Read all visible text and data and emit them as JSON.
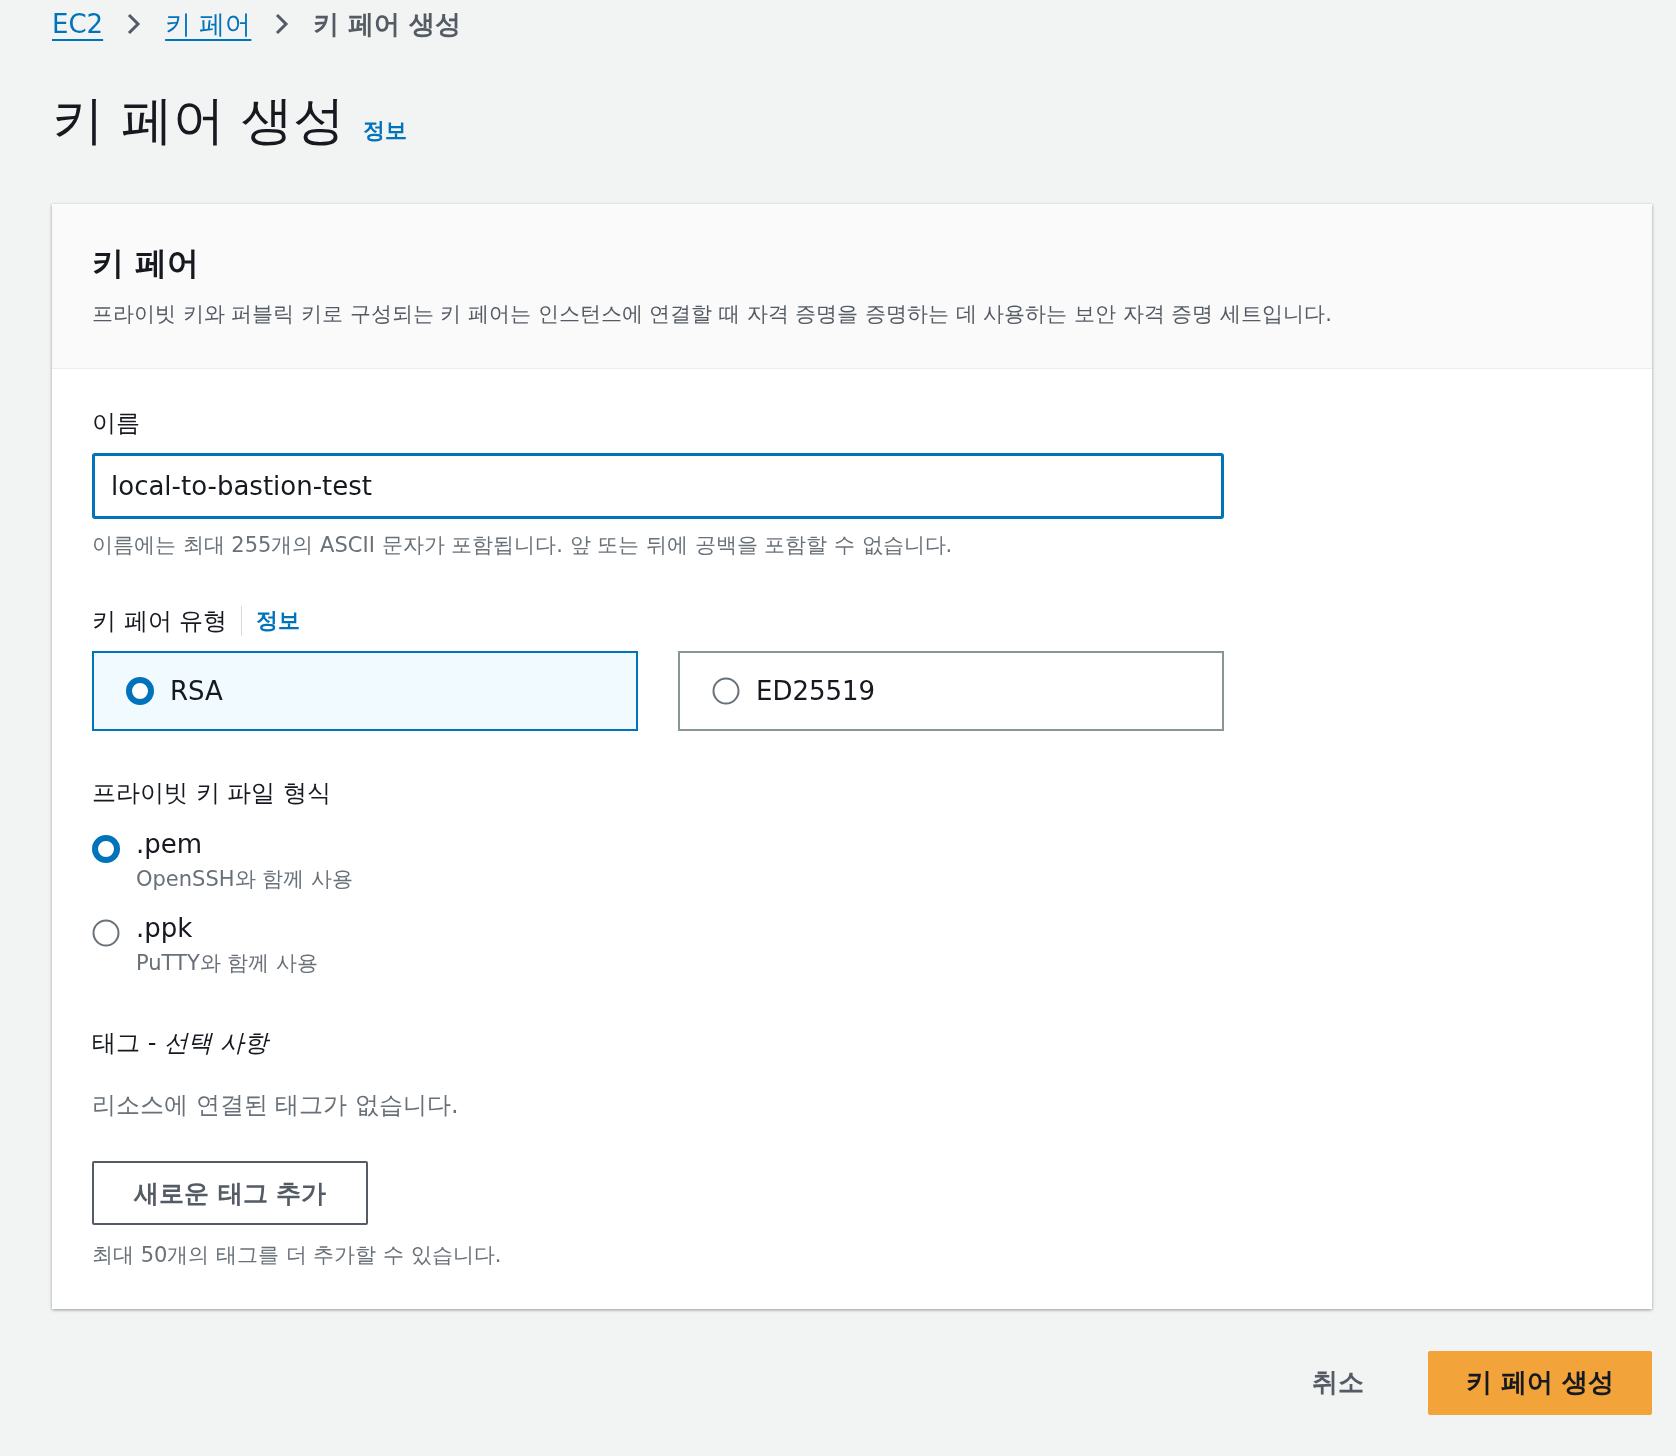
{
  "breadcrumb": [
    {
      "label": "EC2",
      "link": true
    },
    {
      "label": "키 페어",
      "link": true
    },
    {
      "label": "키 페어 생성",
      "link": false
    }
  ],
  "title": "키 페어 생성",
  "title_info": "정보",
  "card": {
    "heading": "키 페어",
    "description": "프라이빗 키와 퍼블릭 키로 구성되는 키 페어는 인스턴스에 연결할 때 자격 증명을 증명하는 데 사용하는 보안 자격 증명 세트입니다."
  },
  "name_field": {
    "label": "이름",
    "value": "local-to-bastion-test",
    "focused": true,
    "hint": "이름에는 최대 255개의 ASCII 문자가 포함됩니다. 앞 또는 뒤에 공백을 포함할 수 없습니다."
  },
  "key_type": {
    "label": "키 페어 유형",
    "info": "정보",
    "options": [
      {
        "label": "RSA",
        "selected": true
      },
      {
        "label": "ED25519",
        "selected": false
      }
    ]
  },
  "file_format": {
    "label": "프라이빗 키 파일 형식",
    "options": [
      {
        "label": ".pem",
        "description": "OpenSSH와 함께 사용",
        "selected": true
      },
      {
        "label": ".ppk",
        "description": "PuTTY와 함께 사용",
        "selected": false
      }
    ]
  },
  "tags": {
    "heading": "태그 - *선택 사항*",
    "empty_text": "리소스에 연결된 태그가 없습니다.",
    "add_button": "새로운 태그 추가",
    "limit_text": "최대 50개의 태그를 더 추가할 수 있습니다."
  },
  "buttons": {
    "cancel": "취소",
    "submit": "키 페어 생성"
  }
}
